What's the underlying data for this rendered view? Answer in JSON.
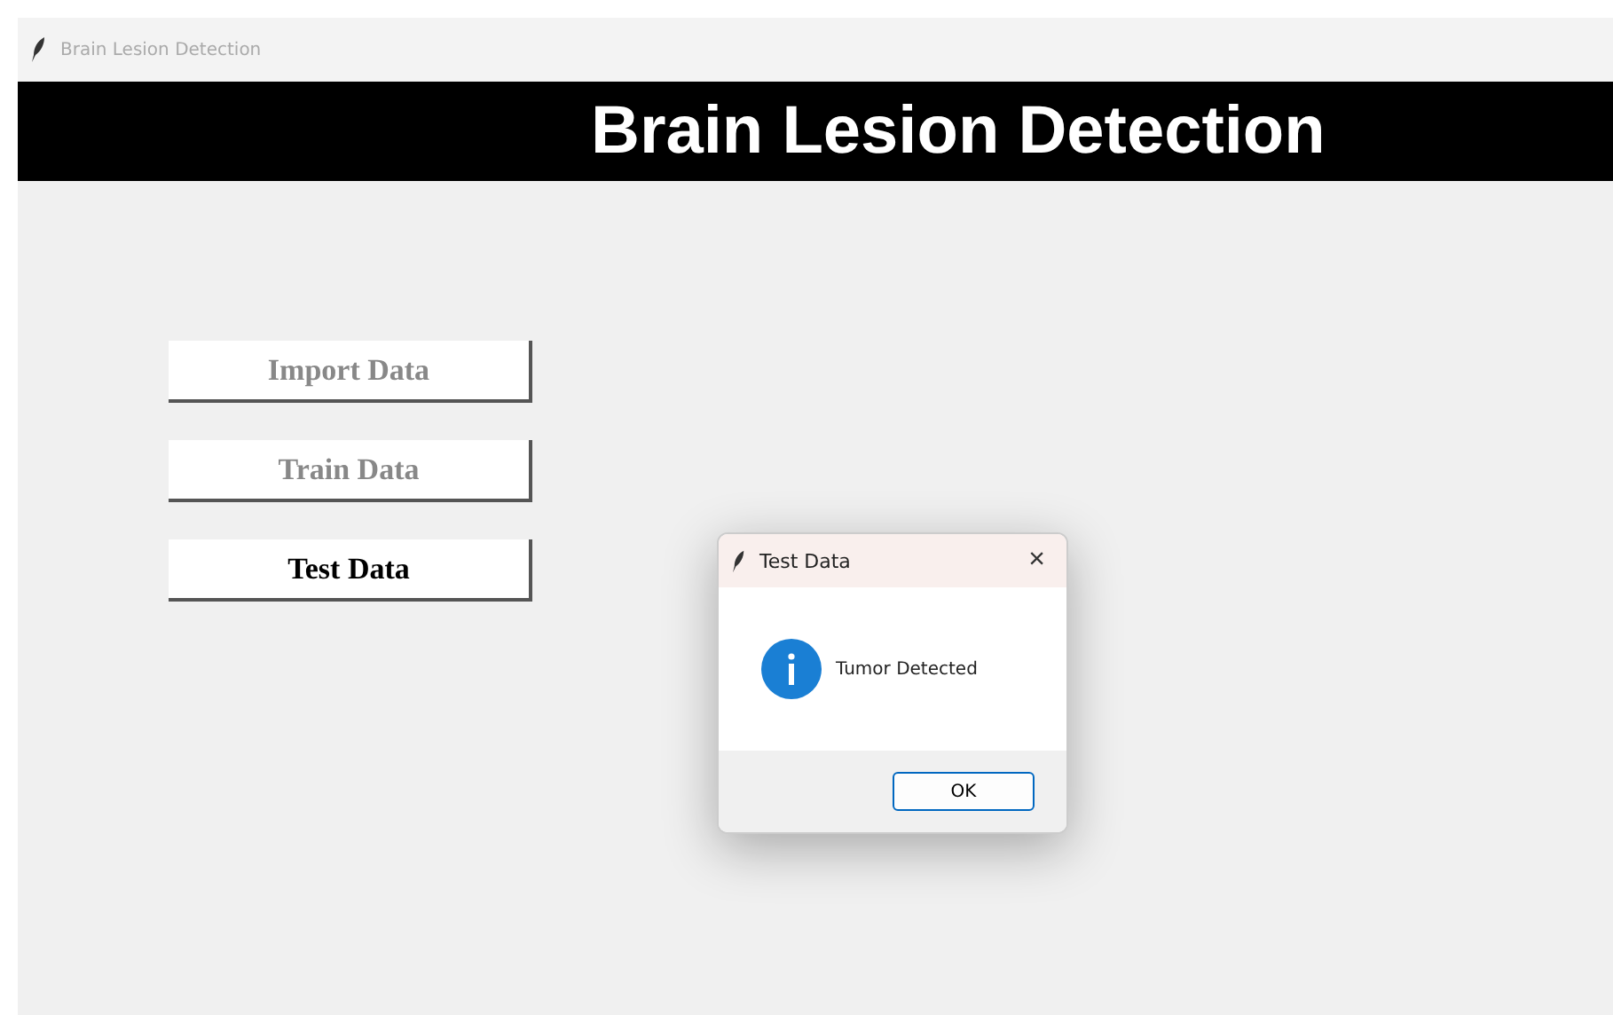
{
  "window": {
    "title": "Brain Lesion Detection"
  },
  "header": {
    "title": "Brain Lesion Detection"
  },
  "buttons": [
    {
      "label": "Import Data",
      "disabled": true
    },
    {
      "label": "Train Data",
      "disabled": true
    },
    {
      "label": "Test Data",
      "disabled": false
    }
  ],
  "dialog": {
    "title": "Test Data",
    "close": "×",
    "message": "Tumor Detected",
    "ok": "OK"
  }
}
